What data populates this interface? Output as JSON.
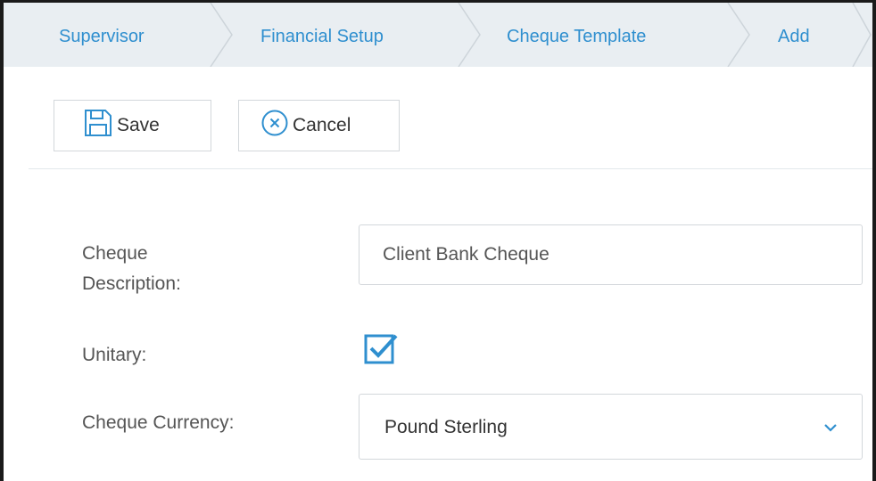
{
  "breadcrumb": {
    "items": [
      {
        "label": "Supervisor"
      },
      {
        "label": "Financial Setup"
      },
      {
        "label": "Cheque Template"
      },
      {
        "label": "Add"
      }
    ]
  },
  "toolbar": {
    "save_label": "Save",
    "cancel_label": "Cancel"
  },
  "form": {
    "description_label_line1": "Cheque",
    "description_label_line2": "Description:",
    "description_value": "Client Bank Cheque",
    "unitary_label": "Unitary:",
    "unitary_checked": true,
    "currency_label": "Cheque Currency:",
    "currency_value": "Pound Sterling"
  },
  "colors": {
    "accent": "#2f8fcf",
    "breadcrumb_bg": "#e9eef2",
    "border": "#d3d7db"
  },
  "icons": {
    "save": "save-icon",
    "cancel": "close-circle-icon",
    "checkbox": "checkbox-checked-icon",
    "chevron": "chevron-down-icon"
  }
}
